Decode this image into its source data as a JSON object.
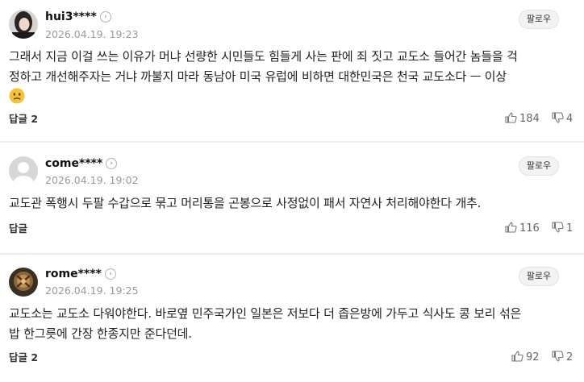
{
  "comments": [
    {
      "username": "hui3****",
      "date": "2026.04.19. 19:23",
      "follow_label": "팔로우",
      "text_line1": "그래서 지금 이걸 쓰는 이유가 머냐 선량한 시민들도 힘들게 사는 판에 죄 짓고 교도소 들어간 놈들을 걱",
      "text_line2": "정하고 개선해주자는 거냐 까불지 마라 동남아 미국 유럽에 비하면 대한민국은 천국 교도소다 ㅡ 이상",
      "reply_label": "답글 2",
      "likes": "184",
      "dislikes": "4"
    },
    {
      "username": "come****",
      "date": "2026.04.19. 19:02",
      "follow_label": "팔로우",
      "text_line1": "교도관 폭행시 두팔 수갑으로 묶고 머리통을 곤봉으로 사정없이 패서 자연사 처리해야한다 개추.",
      "reply_label": "답글",
      "likes": "116",
      "dislikes": "1"
    },
    {
      "username": "rome****",
      "date": "2026.04.19. 19:25",
      "follow_label": "팔로우",
      "text_line1": "교도소는 교도소 다워야한다. 바로옆 민주국가인 일본은 저보다 더 좁은방에 가두고 식사도 콩 보리 섞은",
      "text_line2": "밥 한그릇에 간장 한종지만 준다던데.",
      "reply_label": "답글 2",
      "likes": "92",
      "dislikes": "2"
    }
  ],
  "icons": {
    "chevron": "chevron-right-icon",
    "like": "thumbs-up-icon",
    "dislike": "thumbs-down-icon",
    "emoji": "grimace-emoji-icon"
  },
  "colors": {
    "text": "#222222",
    "muted": "#9a9a9a",
    "divider": "#eeeeee",
    "follow_bg": "#f3f3f3"
  }
}
